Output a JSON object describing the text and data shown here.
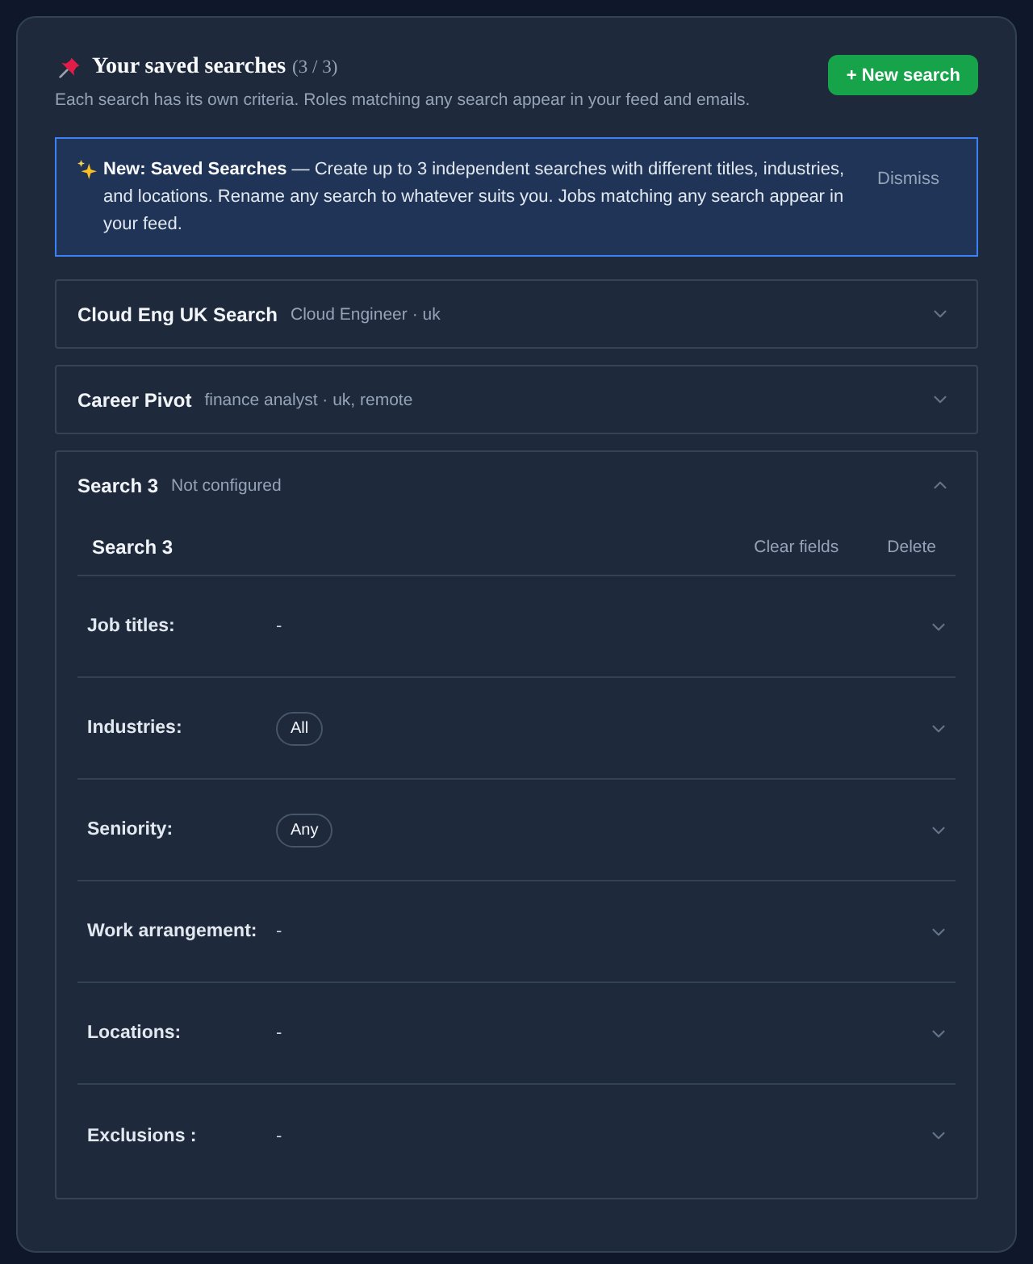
{
  "header": {
    "title": "Your saved searches",
    "count": "(3 / 3)",
    "subtitle": "Each search has its own criteria. Roles matching any search appear in your feed and emails.",
    "new_button": "+ New search"
  },
  "notice": {
    "text": "**New: Saved Searches** — Create up to 3 independent searches with different titles, industries, and locations. Rename any search to whatever suits you. Jobs matching any search appear in your feed.",
    "dismiss": "Dismiss"
  },
  "searches": [
    {
      "title": "Cloud Eng UK Search",
      "summary": "Cloud Engineer · uk",
      "expanded": false
    },
    {
      "title": "Career Pivot",
      "summary": "finance analyst · uk, remote",
      "expanded": false
    },
    {
      "title": "Search 3",
      "summary": "Not configured",
      "expanded": true,
      "editor": {
        "name": "Search 3",
        "actions": [
          "Clear fields",
          "Delete"
        ],
        "fields": [
          {
            "label": "Job titles:",
            "kind": "text",
            "value": "-",
            "expanded": false
          },
          {
            "label": "Industries:",
            "kind": "chips",
            "values": [
              "All"
            ],
            "expanded": false
          },
          {
            "label": "Seniority:",
            "kind": "chips",
            "values": [
              "Any"
            ],
            "expanded": false
          },
          {
            "label": "Work arrangement:",
            "kind": "text",
            "value": "-",
            "expanded": false
          },
          {
            "label": "Locations:",
            "kind": "text",
            "value": "-",
            "expanded": false
          },
          {
            "label": "Exclusions :",
            "kind": "text",
            "value": "-",
            "expanded": false
          }
        ]
      }
    }
  ]
}
